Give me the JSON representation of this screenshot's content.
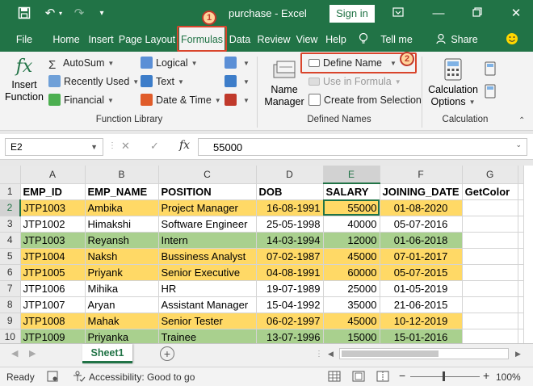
{
  "titlebar": {
    "title": "purchase  -  Excel",
    "signin": "Sign in",
    "icons": [
      "save-icon",
      "undo-icon",
      "redo-icon",
      "customize-qat-icon",
      "ribbon-options-icon",
      "minimize-icon",
      "restore-icon",
      "close-icon"
    ]
  },
  "tabs": [
    "File",
    "Home",
    "Insert",
    "Page Layout",
    "Formulas",
    "Data",
    "Review",
    "View",
    "Help",
    "Tell me",
    "Share"
  ],
  "active_tab": "Formulas",
  "badges": {
    "step1": "1",
    "step2": "2"
  },
  "ribbon": {
    "insert_function": {
      "line1": "Insert",
      "line2": "Function",
      "icon": "fx"
    },
    "autosum": "AutoSum",
    "recently_used": "Recently Used",
    "financial": "Financial",
    "logical": "Logical",
    "text": "Text",
    "date_time": "Date & Time",
    "function_library_label": "Function Library",
    "name_manager": {
      "line1": "Name",
      "line2": "Manager"
    },
    "define_name": "Define Name",
    "use_in_formula": "Use in Formula",
    "create_from_selection": "Create from Selection",
    "defined_names_label": "Defined Names",
    "calc_options": {
      "line1": "Calculation",
      "line2": "Options"
    },
    "calculation_label": "Calculation"
  },
  "formula_bar": {
    "name_box": "E2",
    "fx": "fx",
    "value": "55000"
  },
  "grid": {
    "columns": [
      "A",
      "B",
      "C",
      "D",
      "E",
      "F",
      "G"
    ],
    "selected_column": "E",
    "selected_row": "2",
    "rows": [
      {
        "n": "1",
        "fill": "",
        "cells": [
          "EMP_ID",
          "EMP_NAME",
          "POSITION",
          "DOB",
          "SALARY",
          "JOINING_DATE",
          "GetColor"
        ]
      },
      {
        "n": "2",
        "fill": "y",
        "cells": [
          "JTP1003",
          "Ambika",
          "Project Manager",
          "16-08-1991",
          "55000",
          "01-08-2020",
          ""
        ]
      },
      {
        "n": "3",
        "fill": "",
        "cells": [
          "JTP1002",
          "Himakshi",
          "Software Engineer",
          "25-05-1998",
          "40000",
          "05-07-2016",
          ""
        ]
      },
      {
        "n": "4",
        "fill": "g",
        "cells": [
          "JTP1003",
          "Reyansh",
          "Intern",
          "14-03-1994",
          "12000",
          "01-06-2018",
          ""
        ]
      },
      {
        "n": "5",
        "fill": "y",
        "cells": [
          "JTP1004",
          "Naksh",
          "Bussiness Analyst",
          "07-02-1987",
          "45000",
          "07-01-2017",
          ""
        ]
      },
      {
        "n": "6",
        "fill": "y",
        "cells": [
          "JTP1005",
          "Priyank",
          "Senior Executive",
          "04-08-1991",
          "60000",
          "05-07-2015",
          ""
        ]
      },
      {
        "n": "7",
        "fill": "",
        "cells": [
          "JTP1006",
          "Mihika",
          "HR",
          "19-07-1989",
          "25000",
          "01-05-2019",
          ""
        ]
      },
      {
        "n": "8",
        "fill": "",
        "cells": [
          "JTP1007",
          "Aryan",
          "Assistant Manager",
          "15-04-1992",
          "35000",
          "21-06-2015",
          ""
        ]
      },
      {
        "n": "9",
        "fill": "y",
        "cells": [
          "JTP1008",
          "Mahak",
          "Senior Tester",
          "06-02-1997",
          "45000",
          "10-12-2019",
          ""
        ]
      },
      {
        "n": "10",
        "fill": "g",
        "cells": [
          "JTP1009",
          "Priyanka",
          "Trainee",
          "13-07-1996",
          "15000",
          "15-01-2016",
          ""
        ]
      }
    ]
  },
  "sheet_tab": "Sheet1",
  "status": {
    "ready": "Ready",
    "accessibility": "Accessibility: Good to go",
    "zoom": "100%",
    "minus": "−",
    "plus": "+"
  }
}
